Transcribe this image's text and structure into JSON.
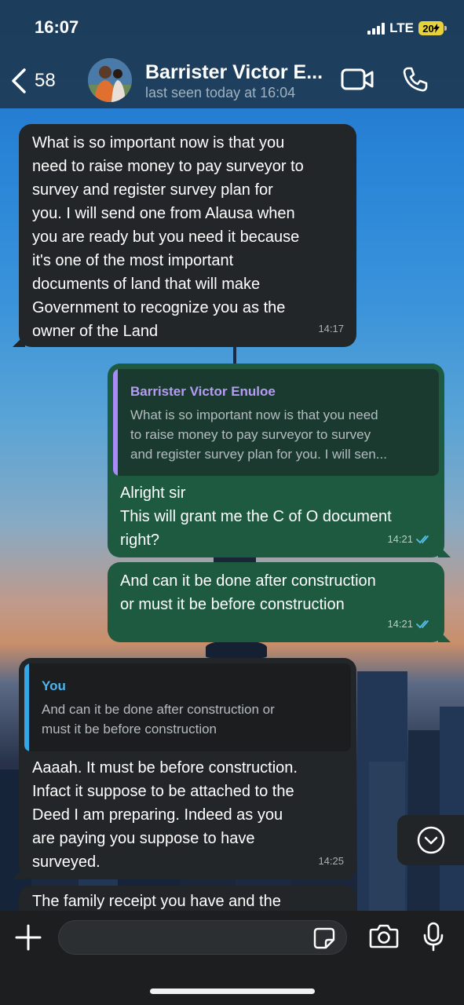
{
  "status_bar": {
    "time": "16:07",
    "network": "LTE",
    "battery": "20"
  },
  "header": {
    "back_count": "58",
    "contact_name": "Barrister Victor E...",
    "last_seen": "last seen today at 16:04"
  },
  "messages": [
    {
      "direction": "incoming",
      "text": "What is so important now is that you\nneed to raise money to pay surveyor to\nsurvey and register survey plan for\nyou. I will send one from Alausa when\nyou are ready but you need it because\nit's one of the most important\ndocuments of land that will make\nGovernment to recognize you as the\nowner of the Land",
      "time": "14:17"
    },
    {
      "direction": "outgoing",
      "quote": {
        "author": "Barrister Victor Enuloe",
        "text": "What is so important now is that you need\nto raise money to pay surveyor to survey\nand register survey plan for you. I will sen..."
      },
      "text": "Alright sir\nThis will grant me the C of O document\nright?",
      "time": "14:21",
      "status": "read"
    },
    {
      "direction": "outgoing",
      "text": "And can it be done after construction\nor must it be before construction",
      "time": "14:21",
      "status": "read"
    },
    {
      "direction": "incoming",
      "quote": {
        "author": "You",
        "text": "And can it be done after construction or\nmust it be before construction"
      },
      "text": "Aaaah. It must be before construction.\nInfact it suppose to be attached to the\nDeed I am preparing. Indeed as you\nare paying you suppose to have\nsurveyed.",
      "time": "14:25"
    },
    {
      "direction": "incoming",
      "text": "The family receipt you have and the",
      "time": ""
    }
  ],
  "colors": {
    "incoming_bubble": "#232628",
    "outgoing_bubble": "#1d5a40",
    "quote_bar_contact": "#a78bfa",
    "quote_bar_you": "#35a7e8",
    "read_ticks": "#53bdeb"
  },
  "icons": {
    "back": "chevron-left-icon",
    "video": "video-camera-icon",
    "call": "phone-icon",
    "scroll": "chevron-down-circle-icon",
    "attach": "plus-icon",
    "sticker": "sticker-icon",
    "camera": "camera-icon",
    "mic": "microphone-icon"
  }
}
